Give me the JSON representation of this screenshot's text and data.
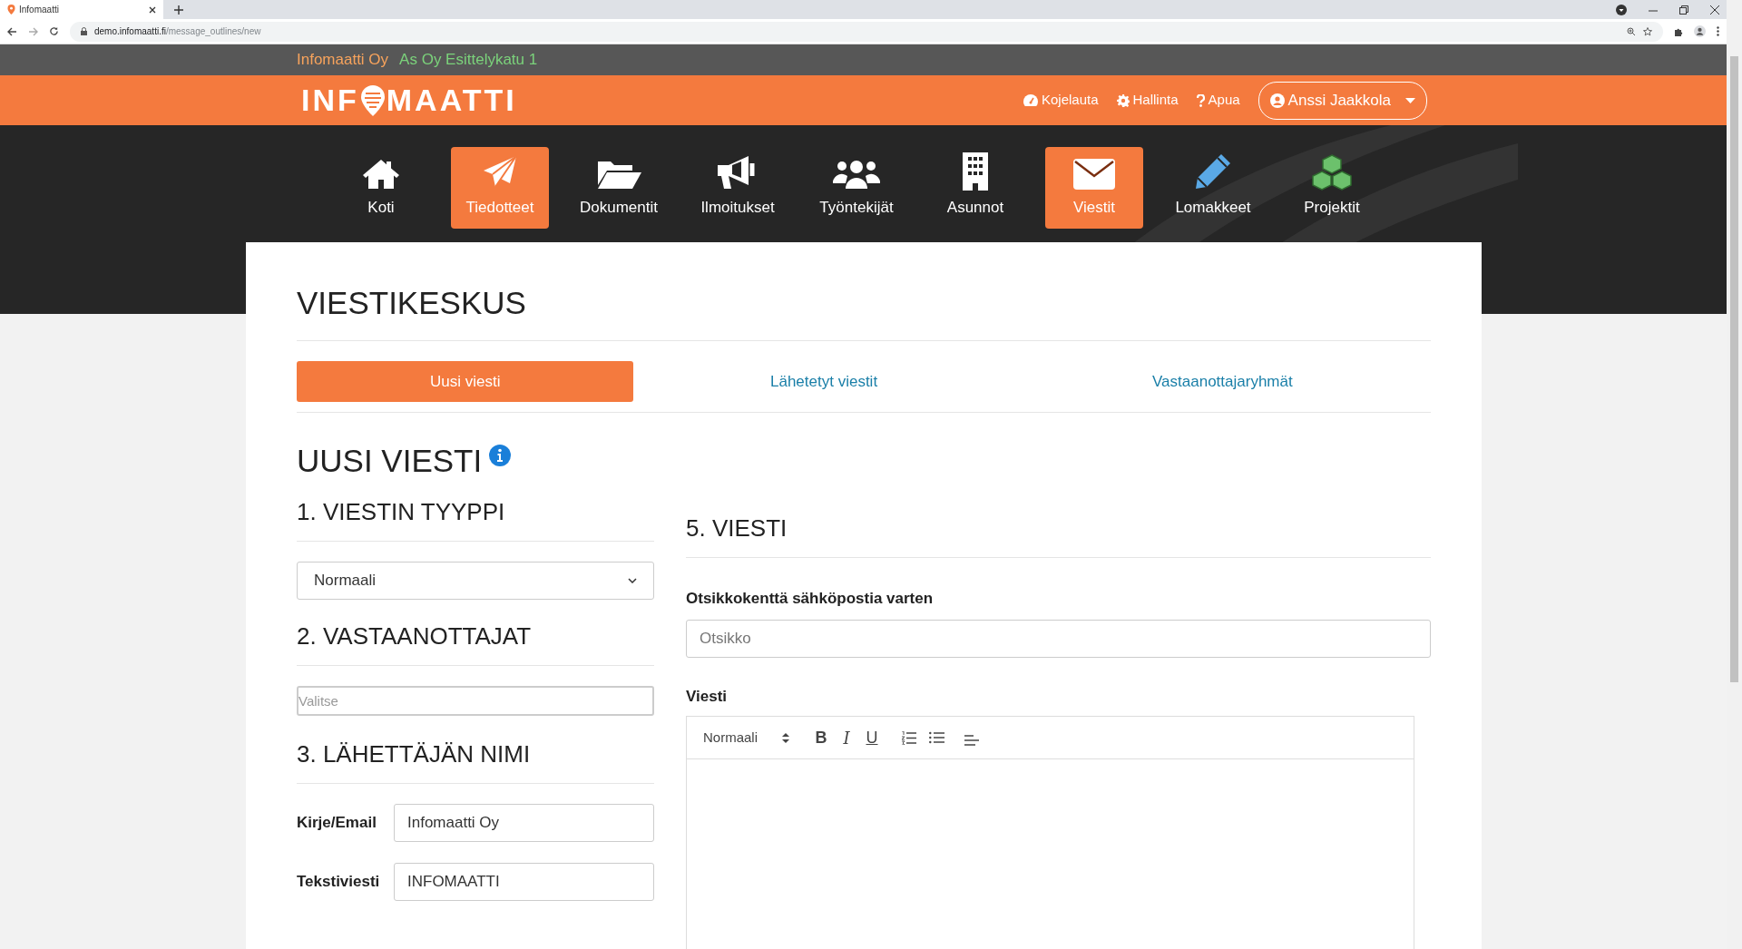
{
  "browser": {
    "tab_title": "Infomaatti",
    "url_host": "demo.infomaatti.fi",
    "url_path": "/message_outlines/new"
  },
  "topbar": {
    "company": "Infomaatti Oy",
    "property": "As Oy Esittelykatu 1"
  },
  "header": {
    "logo_before": "INF",
    "logo_after": "MAATTI",
    "links": [
      {
        "label": "Kojelauta"
      },
      {
        "label": "Hallinta"
      },
      {
        "label": "Apua"
      }
    ],
    "user": "Anssi Jaakkola"
  },
  "nav": [
    {
      "label": "Koti",
      "selected": false
    },
    {
      "label": "Tiedotteet",
      "selected": true
    },
    {
      "label": "Dokumentit",
      "selected": false
    },
    {
      "label": "Ilmoitukset",
      "selected": false
    },
    {
      "label": "Työntekijät",
      "selected": false
    },
    {
      "label": "Asunnot",
      "selected": false
    },
    {
      "label": "Viestit",
      "selected": true
    },
    {
      "label": "Lomakkeet",
      "selected": false
    },
    {
      "label": "Projektit",
      "selected": false
    }
  ],
  "page_title": "VIESTIKESKUS",
  "tabs": [
    {
      "label": "Uusi viesti",
      "selected": true
    },
    {
      "label": "Lähetetyt viestit",
      "selected": false
    },
    {
      "label": "Vastaanottajaryhmät",
      "selected": false
    }
  ],
  "form_title": "UUSI VIESTI",
  "sections": {
    "type": {
      "heading": "1. VIESTIN TYYPPI",
      "value": "Normaali"
    },
    "recipients": {
      "heading": "2. VASTAANOTTAJAT",
      "placeholder": "Valitse"
    },
    "sender": {
      "heading": "3. LÄHETTÄJÄN NIMI",
      "fields": [
        {
          "label": "Kirje/Email",
          "value": "Infomaatti Oy"
        },
        {
          "label": "Tekstiviesti",
          "value": "INFOMAATTI"
        }
      ]
    },
    "message": {
      "heading": "5. VIESTI",
      "subject_label": "Otsikkokenttä sähköpostia varten",
      "subject_placeholder": "Otsikko",
      "body_label": "Viesti",
      "toolbar": {
        "format": "Normaali",
        "bold": "B",
        "italic": "I",
        "underline": "U"
      }
    }
  }
}
